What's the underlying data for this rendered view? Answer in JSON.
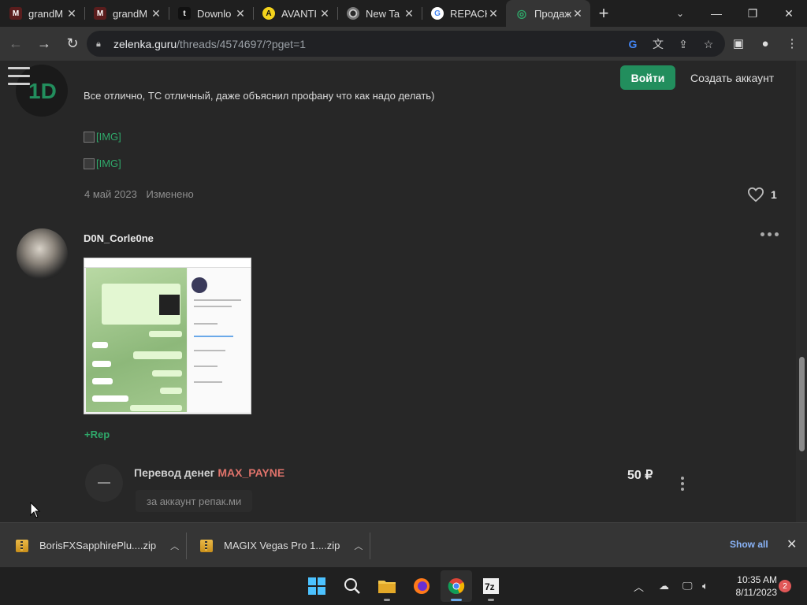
{
  "tabs": [
    {
      "title": "grandM",
      "icon": "mia-icon",
      "active": false
    },
    {
      "title": "grandM",
      "icon": "mia-icon",
      "active": false
    },
    {
      "title": "Downlo",
      "icon": "t-icon",
      "active": false
    },
    {
      "title": "AVANTI",
      "icon": "avanti-icon",
      "active": false
    },
    {
      "title": "New Ta",
      "icon": "chrome-icon",
      "active": false
    },
    {
      "title": "REPACK",
      "icon": "google-icon",
      "active": false
    },
    {
      "title": "Продаж",
      "icon": "lolz-icon",
      "active": true
    }
  ],
  "address": {
    "host": "zelenka.guru",
    "path": "/threads/4574697/?pget=1"
  },
  "header": {
    "login_label": "Войти",
    "register_label": "Создать аккаунт"
  },
  "post1": {
    "avatar_text": "1D",
    "text": "Все отлично, ТС отличный, даже объяснил профану что как надо делать)",
    "images": [
      "[IMG]",
      "[IMG]"
    ],
    "date": "4 май 2023",
    "edited": "Изменено",
    "likes": "1"
  },
  "post2": {
    "author": "D0N_Corle0ne",
    "rep_label": "+Rep",
    "transfer": {
      "title": "Перевод денег",
      "user": "MAX_PAYNE",
      "amount": "50 ₽",
      "comment": "за аккаунт репак.ми"
    }
  },
  "downloads": {
    "items": [
      {
        "name": "BorisFXSapphirePlu....zip"
      },
      {
        "name": "MAGIX Vegas Pro 1....zip"
      }
    ],
    "show_all_label": "Show all"
  },
  "clock": {
    "time": "10:35 AM",
    "date": "8/11/2023"
  },
  "notifications": "2",
  "colors": {
    "accent": "#228e5d",
    "link": "#2fa86a",
    "transfer_user": "#e0736b"
  }
}
